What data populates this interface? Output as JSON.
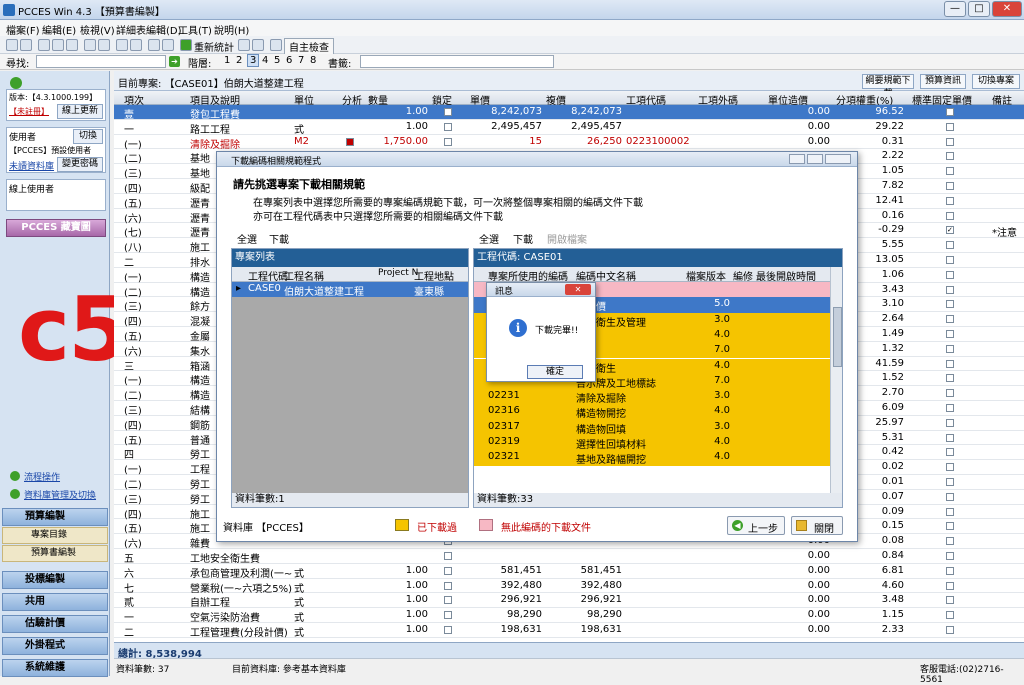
{
  "window": {
    "title": "PCCES Win 4.3 【預算書編製】",
    "min": "—",
    "max": "□",
    "close": "✕"
  },
  "menu": [
    "檔案(F)",
    "編輯(E)",
    "檢視(V)",
    "詳細表編輯(D)",
    "工具(T)",
    "說明(H)"
  ],
  "toolbar": {
    "recalc": "重新統計",
    "selfcheck": "自主檢查"
  },
  "findbar": {
    "find_label": "尋找:",
    "level_label": "階層:",
    "levels": [
      "1",
      "2",
      "3",
      "4",
      "5",
      "6",
      "7",
      "8"
    ],
    "selected_level": "3",
    "book_label": "書籤:"
  },
  "sidebar": {
    "version": "版本:【4.3.1000.199】",
    "unregistered": "【未註冊】",
    "online_update": "線上更新",
    "user_label": "使用者",
    "switch": "切換",
    "user": "【PCCES】預設使用者",
    "unread": "未讀資料庫",
    "change_pwd": "變更密碼",
    "online_users": "線上使用者",
    "banner": "PCCES 藏寶圖",
    "flow": "流程操作",
    "dbmanage": "資料庫管理及切換",
    "nav": [
      "預算編製",
      "專案目錄",
      "預算書編製",
      "投標編製",
      "共用",
      "估驗計價",
      "外掛程式",
      "系統維護"
    ]
  },
  "overlay_label": "c5",
  "main": {
    "project": "目前專案: 【CASE01】伯朗大道整建工程",
    "btns": [
      "綱要規範下載",
      "預算資訊",
      "切換專案"
    ],
    "headers": [
      "項次",
      "項目及說明",
      "單位",
      "分析",
      "數量",
      "鎖定",
      "單價",
      "複價",
      "工項代碼",
      "工項外碼",
      "單位造價",
      "分項權重(%)",
      "標準固定單價",
      "備註"
    ],
    "rows": [
      {
        "no": "壹",
        "desc": "發包工程費",
        "unit": "",
        "qty": "1.00",
        "price": "8,242,073",
        "total": "8,242,073",
        "code": "",
        "ucost": "0.00",
        "weight": "96.52",
        "note": "",
        "sel": true
      },
      {
        "no": "一",
        "desc": "路工工程",
        "unit": "式",
        "qty": "1.00",
        "price": "2,495,457",
        "total": "2,495,457",
        "code": "",
        "ucost": "0.00",
        "weight": "29.22",
        "note": ""
      },
      {
        "no": "(一)",
        "desc": "清除及掘除",
        "unit": "M2",
        "qty": "1,750.00",
        "price": "15",
        "total": "26,250",
        "code": "0223100002",
        "ucost": "0.00",
        "weight": "0.31",
        "note": "",
        "red": true
      },
      {
        "no": "(二)",
        "desc": "基地",
        "unit": "",
        "qty": "",
        "price": "",
        "total": "",
        "code": "",
        "ucost": "0.00",
        "weight": "2.22",
        "note": ""
      },
      {
        "no": "(三)",
        "desc": "基地",
        "unit": "",
        "qty": "",
        "price": "",
        "total": "",
        "code": "",
        "ucost": "0.00",
        "weight": "1.05",
        "note": ""
      },
      {
        "no": "(四)",
        "desc": "級配",
        "unit": "",
        "qty": "",
        "price": "",
        "total": "",
        "code": "",
        "ucost": "0.00",
        "weight": "7.82",
        "note": ""
      },
      {
        "no": "(五)",
        "desc": "瀝青",
        "unit": "",
        "qty": "",
        "price": "",
        "total": "",
        "code": "",
        "ucost": "0.00",
        "weight": "12.41",
        "note": ""
      },
      {
        "no": "(六)",
        "desc": "瀝青",
        "unit": "",
        "qty": "",
        "price": "",
        "total": "",
        "code": "",
        "ucost": "0.00",
        "weight": "0.16",
        "note": ""
      },
      {
        "no": "(七)",
        "desc": "瀝青",
        "unit": "",
        "qty": "",
        "price": "",
        "total": "",
        "code": "",
        "ucost": "0.00",
        "weight": "-0.29",
        "note": "*注意",
        "checked": true
      },
      {
        "no": "(八)",
        "desc": "施工",
        "unit": "",
        "qty": "",
        "price": "",
        "total": "",
        "code": "",
        "ucost": "0.00",
        "weight": "5.55",
        "note": ""
      },
      {
        "no": "二",
        "desc": "排水",
        "unit": "",
        "qty": "",
        "price": "",
        "total": "",
        "code": "",
        "ucost": "0.00",
        "weight": "13.05",
        "note": ""
      },
      {
        "no": "(一)",
        "desc": "構造",
        "unit": "",
        "qty": "",
        "price": "",
        "total": "",
        "code": "",
        "ucost": "0.00",
        "weight": "1.06",
        "note": ""
      },
      {
        "no": "(二)",
        "desc": "構造",
        "unit": "",
        "qty": "",
        "price": "",
        "total": "",
        "code": "",
        "ucost": "0.00",
        "weight": "3.43",
        "note": ""
      },
      {
        "no": "(三)",
        "desc": "餘方",
        "unit": "",
        "qty": "",
        "price": "",
        "total": "",
        "code": "",
        "ucost": "0.00",
        "weight": "3.10",
        "note": ""
      },
      {
        "no": "(四)",
        "desc": "混凝",
        "unit": "",
        "qty": "",
        "price": "",
        "total": "",
        "code": "",
        "ucost": "0.00",
        "weight": "2.64",
        "note": ""
      },
      {
        "no": "(五)",
        "desc": "金屬",
        "unit": "",
        "qty": "",
        "price": "",
        "total": "",
        "code": "",
        "ucost": "0.00",
        "weight": "1.49",
        "note": ""
      },
      {
        "no": "(六)",
        "desc": "集水",
        "unit": "",
        "qty": "",
        "price": "",
        "total": "",
        "code": "",
        "ucost": "0.00",
        "weight": "1.32",
        "note": ""
      },
      {
        "no": "三",
        "desc": "箱涵",
        "unit": "",
        "qty": "",
        "price": "",
        "total": "",
        "code": "",
        "ucost": "0.00",
        "weight": "41.59",
        "note": ""
      },
      {
        "no": "(一)",
        "desc": "構造",
        "unit": "",
        "qty": "",
        "price": "",
        "total": "",
        "code": "",
        "ucost": "0.00",
        "weight": "1.52",
        "note": ""
      },
      {
        "no": "(二)",
        "desc": "構造",
        "unit": "",
        "qty": "",
        "price": "",
        "total": "",
        "code": "",
        "ucost": "0.00",
        "weight": "2.70",
        "note": ""
      },
      {
        "no": "(三)",
        "desc": "結構",
        "unit": "",
        "qty": "",
        "price": "",
        "total": "",
        "code": "",
        "ucost": "0.00",
        "weight": "6.09",
        "note": ""
      },
      {
        "no": "(四)",
        "desc": "鋼筋",
        "unit": "",
        "qty": "",
        "price": "",
        "total": "",
        "code": "",
        "ucost": "0.00",
        "weight": "25.97",
        "note": ""
      },
      {
        "no": "(五)",
        "desc": "普通",
        "unit": "",
        "qty": "",
        "price": "",
        "total": "",
        "code": "",
        "ucost": "0.00",
        "weight": "5.31",
        "note": ""
      },
      {
        "no": "四",
        "desc": "勞工",
        "unit": "",
        "qty": "",
        "price": "",
        "total": "",
        "code": "",
        "ucost": "0.00",
        "weight": "0.42",
        "note": ""
      },
      {
        "no": "(一)",
        "desc": "工程",
        "unit": "",
        "qty": "",
        "price": "",
        "total": "",
        "code": "",
        "ucost": "0.00",
        "weight": "0.02",
        "note": ""
      },
      {
        "no": "(二)",
        "desc": "勞工",
        "unit": "",
        "qty": "",
        "price": "",
        "total": "",
        "code": "",
        "ucost": "0.00",
        "weight": "0.01",
        "note": ""
      },
      {
        "no": "(三)",
        "desc": "勞工",
        "unit": "",
        "qty": "",
        "price": "",
        "total": "",
        "code": "",
        "ucost": "0.00",
        "weight": "0.07",
        "note": ""
      },
      {
        "no": "(四)",
        "desc": "施工",
        "unit": "",
        "qty": "",
        "price": "",
        "total": "",
        "code": "",
        "ucost": "0.00",
        "weight": "0.09",
        "note": ""
      },
      {
        "no": "(五)",
        "desc": "施工",
        "unit": "",
        "qty": "",
        "price": "",
        "total": "",
        "code": "",
        "ucost": "0.00",
        "weight": "0.15",
        "note": ""
      },
      {
        "no": "(六)",
        "desc": "雜費",
        "unit": "",
        "qty": "",
        "price": "",
        "total": "",
        "code": "",
        "ucost": "0.00",
        "weight": "0.08",
        "note": ""
      },
      {
        "no": "五",
        "desc": "工地安全衛生費",
        "unit": "",
        "qty": "",
        "price": "",
        "total": "",
        "code": "",
        "ucost": "0.00",
        "weight": "0.84",
        "note": ""
      },
      {
        "no": "六",
        "desc": "承包商管理及利潤(一~",
        "unit": "式",
        "qty": "1.00",
        "price": "581,451",
        "total": "581,451",
        "code": "",
        "ucost": "0.00",
        "weight": "6.81",
        "note": ""
      },
      {
        "no": "七",
        "desc": "營業稅(一~六項之5%)",
        "unit": "式",
        "qty": "1.00",
        "price": "392,480",
        "total": "392,480",
        "code": "",
        "ucost": "0.00",
        "weight": "4.60",
        "note": ""
      },
      {
        "no": "貳",
        "desc": "自辦工程",
        "unit": "式",
        "qty": "1.00",
        "price": "296,921",
        "total": "296,921",
        "code": "",
        "ucost": "0.00",
        "weight": "3.48",
        "note": ""
      },
      {
        "no": "一",
        "desc": "空氣污染防治費",
        "unit": "式",
        "qty": "1.00",
        "price": "98,290",
        "total": "98,290",
        "code": "",
        "ucost": "0.00",
        "weight": "1.15",
        "note": ""
      },
      {
        "no": "二",
        "desc": "工程管理費(分段計價)",
        "unit": "式",
        "qty": "1.00",
        "price": "198,631",
        "total": "198,631",
        "code": "",
        "ucost": "0.00",
        "weight": "2.33",
        "note": ""
      }
    ],
    "total": "總計: 8,538,994"
  },
  "status": {
    "records": "資料筆數: 37",
    "db": "目前資料庫: 參考基本資料庫",
    "phone": "客服電話:(02)2716-5561"
  },
  "dialog": {
    "title": "下載編碼相關規範程式",
    "heading": "請先挑選專案下載相關規範",
    "line1": "在專案列表中選擇您所需要的專案編碼規範下載，可一次將整個專案相關的編碼文件下載",
    "line2": "亦可在工程代碼表中只選擇您所需要的相關編碼文件下載",
    "left": {
      "select_all": "全選",
      "download": "下載",
      "title": "專案列表",
      "headers": [
        "工程代碼",
        "工程名稱",
        "Project N",
        "工程地點"
      ],
      "row": [
        "CASE0",
        "伯朗大道整建工程",
        "",
        "臺東縣"
      ],
      "count": "資料筆數:1"
    },
    "right": {
      "select_all": "全選",
      "download": "下載",
      "open": "開啟檔案",
      "title": "工程代碼: CASE01",
      "headers": [
        "專案所使用的編碼",
        "編碼中文名稱",
        "檔案版本",
        "編修",
        "最後開啟時間"
      ],
      "rows": [
        {
          "code": "",
          "name": "",
          "ver": "",
          "style": "pink"
        },
        {
          "code": "",
          "name": "網計價",
          "ver": "5.0",
          "style": "sel"
        },
        {
          "code": "",
          "name": "安全衛生及管理",
          "ver": "3.0",
          "style": "y"
        },
        {
          "code": "",
          "name": "維持",
          "ver": "4.0",
          "style": "y"
        },
        {
          "code": "",
          "name": "圖籍",
          "ver": "7.0",
          "style": "y"
        },
        {
          "code": "",
          "name": "安全衛生",
          "ver": "4.0",
          "style": "y"
        },
        {
          "code": "",
          "name": "告示牌及工地標誌",
          "ver": "7.0",
          "style": "y"
        },
        {
          "code": "02231",
          "name": "清除及掘除",
          "ver": "3.0",
          "style": "y"
        },
        {
          "code": "02316",
          "name": "構造物開挖",
          "ver": "4.0",
          "style": "y"
        },
        {
          "code": "02317",
          "name": "構造物回填",
          "ver": "3.0",
          "style": "y"
        },
        {
          "code": "02319",
          "name": "選擇性回填材料",
          "ver": "4.0",
          "style": "y"
        },
        {
          "code": "02321",
          "name": "基地及路幅開挖",
          "ver": "4.0",
          "style": "y"
        }
      ],
      "count": "資料筆數:33"
    },
    "db_label": "資料庫 【PCCES】",
    "legend_downloaded": "已下載過",
    "legend_nofile": "無此編碼的下載文件",
    "back": "上一步",
    "close": "關閉",
    "colors": {
      "downloaded": "#f5c400",
      "nofile": "#f7b8c4"
    }
  },
  "msgbox": {
    "title": "訊息",
    "text": "下載完畢!!",
    "ok": "確定"
  }
}
